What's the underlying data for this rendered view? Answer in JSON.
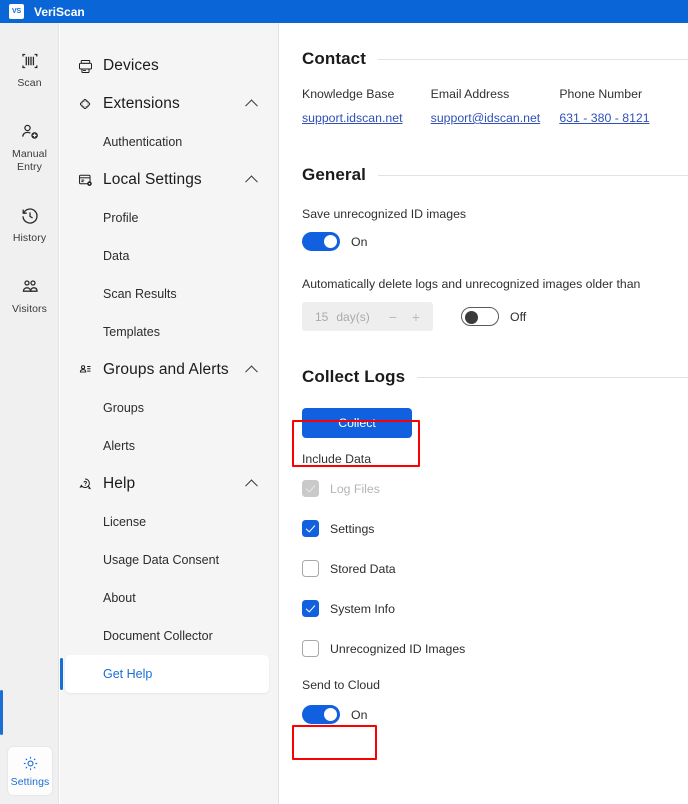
{
  "titlebar": {
    "logo": "VS",
    "app_name": "VeriScan",
    "logo_icon": "veriscan-logo-icon"
  },
  "rail": {
    "items": [
      {
        "label": "Scan",
        "icon": "barcode-scan-icon"
      },
      {
        "label": "Manual\nEntry",
        "label_line1": "Manual",
        "label_line2": "Entry",
        "icon": "person-add-icon"
      },
      {
        "label": "History",
        "icon": "clock-history-icon"
      },
      {
        "label": "Visitors",
        "icon": "visitors-people-icon"
      }
    ],
    "settings": {
      "label": "Settings",
      "icon": "gear-icon",
      "active": true
    }
  },
  "nav": {
    "groups": [
      {
        "label": "Devices",
        "icon": "devices-printer-icon",
        "expandable": false,
        "children": []
      },
      {
        "label": "Extensions",
        "icon": "puzzle-piece-icon",
        "expandable": true,
        "chevron": "chevron-up-icon",
        "children": [
          {
            "label": "Authentication",
            "active": false
          }
        ]
      },
      {
        "label": "Local Settings",
        "icon": "settings-window-icon",
        "expandable": true,
        "chevron": "chevron-up-icon",
        "children": [
          {
            "label": "Profile",
            "active": false
          },
          {
            "label": "Data",
            "active": false
          },
          {
            "label": "Scan Results",
            "active": false
          },
          {
            "label": "Templates",
            "active": false
          }
        ]
      },
      {
        "label": "Groups and Alerts",
        "icon": "groups-people-icon",
        "expandable": true,
        "chevron": "chevron-up-icon",
        "children": [
          {
            "label": "Groups",
            "active": false
          },
          {
            "label": "Alerts",
            "active": false
          }
        ]
      },
      {
        "label": "Help",
        "icon": "help-question-bubble-icon",
        "expandable": true,
        "chevron": "chevron-up-icon",
        "children": [
          {
            "label": "License",
            "active": false
          },
          {
            "label": "Usage Data Consent",
            "active": false
          },
          {
            "label": "About",
            "active": false
          },
          {
            "label": "Document Collector",
            "active": false
          },
          {
            "label": "Get Help",
            "active": true
          }
        ]
      }
    ]
  },
  "main": {
    "contact": {
      "title": "Contact",
      "columns": [
        {
          "label": "Knowledge Base",
          "value": "support.idscan.net"
        },
        {
          "label": "Email Address",
          "value": "support@idscan.net"
        },
        {
          "label": "Phone Number",
          "value": "631 - 380 - 8121"
        }
      ]
    },
    "general": {
      "title": "General",
      "save_images_label": "Save unrecognized ID images",
      "save_images_toggle": {
        "state": "on",
        "text": "On"
      },
      "autodelete_label": "Automatically delete logs and unrecognized images older than",
      "autodelete_value": "15",
      "autodelete_unit": "day(s)",
      "stepper_minus": "−",
      "stepper_plus": "+",
      "autodelete_toggle": {
        "state": "off",
        "text": "Off"
      }
    },
    "collect_logs": {
      "title": "Collect Logs",
      "collect_button": "Collect",
      "include_data_label": "Include Data",
      "checkboxes": [
        {
          "label": "Log Files",
          "state": "disabled-checked"
        },
        {
          "label": "Settings",
          "state": "checked"
        },
        {
          "label": "Stored Data",
          "state": "unchecked"
        },
        {
          "label": "System Info",
          "state": "checked"
        },
        {
          "label": "Unrecognized ID Images",
          "state": "unchecked"
        }
      ],
      "send_to_cloud_label": "Send to Cloud",
      "send_to_cloud_toggle": {
        "state": "on",
        "text": "On"
      }
    }
  },
  "colors": {
    "title_bar": "#0a66d6",
    "accent": "#1160e0",
    "link": "#3050b8",
    "highlight_box": "#fb0000",
    "rail_bg": "#f0f0f0",
    "nav_bg": "#f5f5f5"
  }
}
